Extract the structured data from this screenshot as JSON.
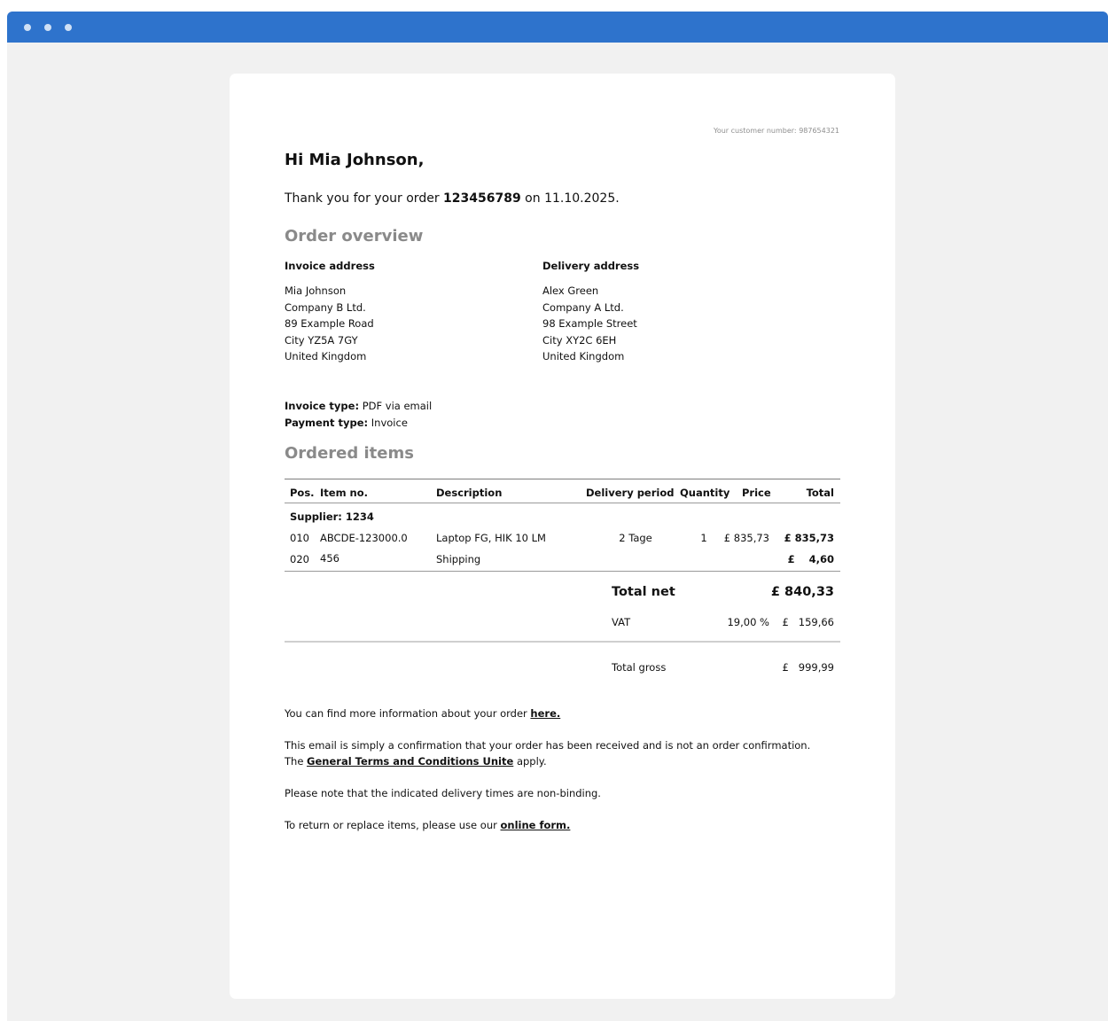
{
  "email": {
    "customer_number_label": "Your customer number:",
    "customer_number": "987654321",
    "greeting": "Hi Mia Johnson,",
    "thanks_prefix": "Thank you for your order",
    "order_number": "123456789",
    "thanks_on": "on",
    "order_date": "11.10.2025.",
    "overview_heading": "Order overview",
    "invoice_address": {
      "heading": "Invoice address",
      "lines": [
        "Mia Johnson",
        "Company B Ltd.",
        "89 Example Road",
        "City YZ5A 7GY",
        "United Kingdom"
      ]
    },
    "delivery_address": {
      "heading": "Delivery address",
      "lines": [
        "Alex Green",
        "Company A Ltd.",
        "98 Example Street",
        "City XY2C 6EH",
        "United Kingdom"
      ]
    },
    "invoice_type_label": "Invoice type:",
    "invoice_type": "PDF via email",
    "payment_type_label": "Payment type:",
    "payment_type": "Invoice",
    "items_heading": "Ordered items",
    "table": {
      "headers": {
        "pos": "Pos.",
        "item_no": "Item no.",
        "description": "Description",
        "delivery_period": "Delivery period",
        "quantity": "Quantity",
        "price": "Price",
        "total": "Total"
      },
      "supplier": "Supplier: 1234",
      "rows": [
        {
          "pos": "010",
          "item_no": "ABCDE-123000.0",
          "description": "Laptop FG, HIK 10 LM",
          "delivery_period": "2 Tage",
          "quantity": "1",
          "price": "£ 835,73",
          "total": "£ 835,73"
        },
        {
          "pos": "020",
          "item_no": "456",
          "description": "Shipping",
          "delivery_period": "",
          "quantity": "",
          "price": "",
          "total": "£    4,60"
        }
      ],
      "total_net_label": "Total net",
      "total_net": "£ 840,33",
      "vat_label": "VAT",
      "vat_rate": "19,00 %",
      "vat_amount": "£   159,66",
      "total_gross_label": "Total gross",
      "total_gross": "£   999,99"
    },
    "footer": {
      "info_prefix": "You can find more information about your order",
      "info_link": "here.",
      "confirm_line": "This email is simply a confirmation that your order has been received and is not an order confirmation.",
      "terms_prefix": "The",
      "terms_link": "General Terms and Conditions Unite",
      "terms_suffix": "apply.",
      "delivery_note": "Please note that the indicated delivery times are non-binding.",
      "return_prefix": "To return or replace items, please use our",
      "return_link": "online form."
    }
  },
  "colors": {
    "titlebar": "#2e73cc",
    "window_bg": "#f1f1f1",
    "heading_gray": "#8a8a8a"
  }
}
